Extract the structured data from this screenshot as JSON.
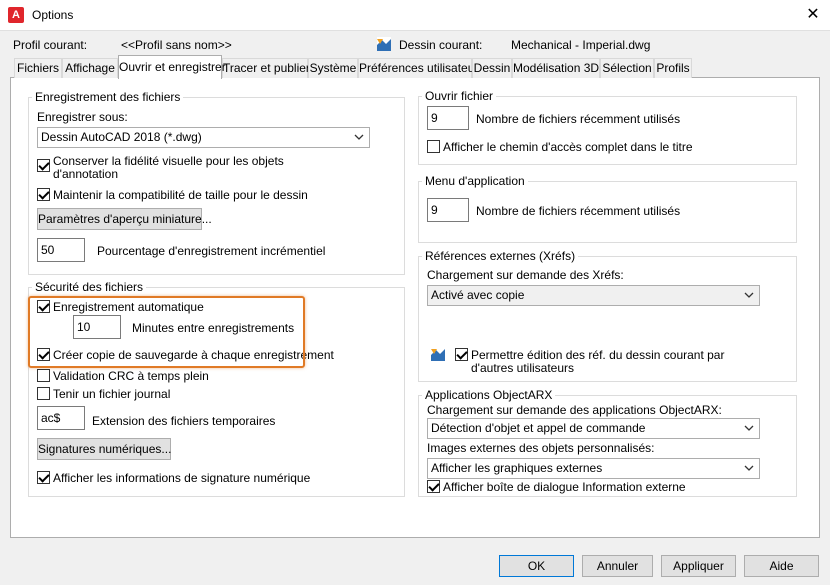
{
  "window": {
    "title": "Options",
    "app_logo": "A",
    "close": "✕"
  },
  "header": {
    "profile_label": "Profil courant:",
    "profile_value": "<<Profil sans nom>>",
    "drawing_label": "Dessin courant:",
    "drawing_value": "Mechanical - Imperial.dwg"
  },
  "tabs": [
    "Fichiers",
    "Affichage",
    "Ouvrir et enregistrer",
    "Tracer et publier",
    "Système",
    "Préférences utilisateur",
    "Dessin",
    "Modélisation 3D",
    "Sélection",
    "Profils"
  ],
  "left": {
    "save_group": {
      "title": "Enregistrement des fichiers",
      "save_as_label": "Enregistrer sous:",
      "save_as_value": "Dessin AutoCAD 2018 (*.dwg)",
      "keep_visual_line1": "Conserver la fidélité visuelle pour les objets",
      "keep_visual_line2": "d'annotation",
      "keep_compat": "Maintenir la compatibilité de taille pour le dessin",
      "thumb_button": "Paramètres d'aperçu miniature...",
      "incr_value": "50",
      "incr_label": "Pourcentage d'enregistrement incrémentiel"
    },
    "security_group": {
      "title": "Sécurité des fichiers",
      "autosave": "Enregistrement automatique",
      "minutes_value": "10",
      "minutes_label": "Minutes entre enregistrements",
      "backup": "Créer copie de sauvegarde à chaque enregistrement",
      "crc": "Validation CRC à temps plein",
      "journal": "Tenir un fichier journal",
      "temp_ext_value": "ac$",
      "temp_ext_label": "Extension des fichiers temporaires",
      "signatures_button": "Signatures numériques...",
      "show_signature": "Afficher les informations de signature numérique"
    }
  },
  "right": {
    "open_group": {
      "title": "Ouvrir fichier",
      "recent_value": "9",
      "recent_label": "Nombre de fichiers récemment utilisés",
      "full_path": "Afficher le chemin d'accès complet dans le titre"
    },
    "app_menu_group": {
      "title": "Menu d'application",
      "recent_value": "9",
      "recent_label": "Nombre de fichiers récemment utilisés"
    },
    "xref_group": {
      "title": "Références externes (Xréfs)",
      "demand_label": "Chargement sur demande des Xréfs:",
      "demand_value": "Activé avec copie",
      "allow_edit_line1": "Permettre édition des réf. du dessin courant par",
      "allow_edit_line2": "d'autres utilisateurs"
    },
    "arx_group": {
      "title": "Applications ObjectARX",
      "demand_label": "Chargement sur demande des applications ObjectARX:",
      "demand_value": "Détection d'objet et appel de commande",
      "proxy_label": "Images externes des objets personnalisés:",
      "proxy_value": "Afficher les graphiques externes",
      "proxy_dialog": "Afficher boîte de dialogue Information externe"
    }
  },
  "footer": {
    "ok": "OK",
    "cancel": "Annuler",
    "apply": "Appliquer",
    "help": "Aide"
  }
}
